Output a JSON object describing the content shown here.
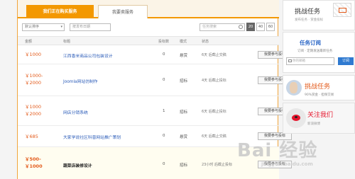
{
  "tabs": [
    {
      "label": "我们正在购买服务",
      "active": true
    },
    {
      "label": "我要卖服务",
      "active": false
    }
  ],
  "filters": {
    "sort_value": "默认排序",
    "date_placeholder": "按发布日期",
    "search_placeholder": "任务搜索"
  },
  "pager": [
    "20",
    "40",
    "60"
  ],
  "table": {
    "headers": [
      "金额",
      "标题",
      "投标数",
      "模式",
      "状态"
    ],
    "rows": [
      {
        "price": "￥1000",
        "title": "江西香米商品公司包装设计",
        "count": "0",
        "mode": "悬赏",
        "status": "6天 后截止交稿",
        "action": "我要参与投标"
      },
      {
        "price": "￥1000-\n￥2000",
        "title": "Joomla网站仿制作",
        "count": "0",
        "mode": "招标",
        "status": "4天 后截止投标",
        "action": "我要参与投标"
      },
      {
        "price": "￥1000\n￥2000",
        "title": "网店分销系统",
        "count": "1",
        "mode": "招标",
        "status": "6天 后截止投标",
        "action": "我要参与投标"
      },
      {
        "price": "￥685",
        "title": "大家学说社区科普网站推广策划",
        "count": "0",
        "mode": "悬赏",
        "status": "6天 后截止交稿",
        "action": "我要参与投标"
      },
      {
        "price": "￥500-\n￥1000",
        "title": "蔬菜店装修设计",
        "count": "0",
        "mode": "招标",
        "status": "23小时 后截止投标",
        "action": "我要参与投标"
      }
    ]
  },
  "sidebar": {
    "challenge_title": "挑战任务",
    "challenge_sub": "发布任务 · 赏金投标",
    "subscribe_title": "任务订阅",
    "subscribe_sub": "订阅 · 定期发送最新任务",
    "email_placeholder": "你的邮箱",
    "subscribe_button": "订阅",
    "promo_title": "挑战任务",
    "promo_sub": "90%赏金 · 担保交易",
    "follow_title": "关注我们",
    "follow_sub": "新浪微博"
  },
  "watermark": {
    "text": "Bai 经验",
    "url": "jingyan.baidu.com"
  },
  "colors": {
    "accent": "#f39800",
    "price": "#e35a1a",
    "link": "#2a5bb8",
    "weibo": "#e6162d"
  }
}
